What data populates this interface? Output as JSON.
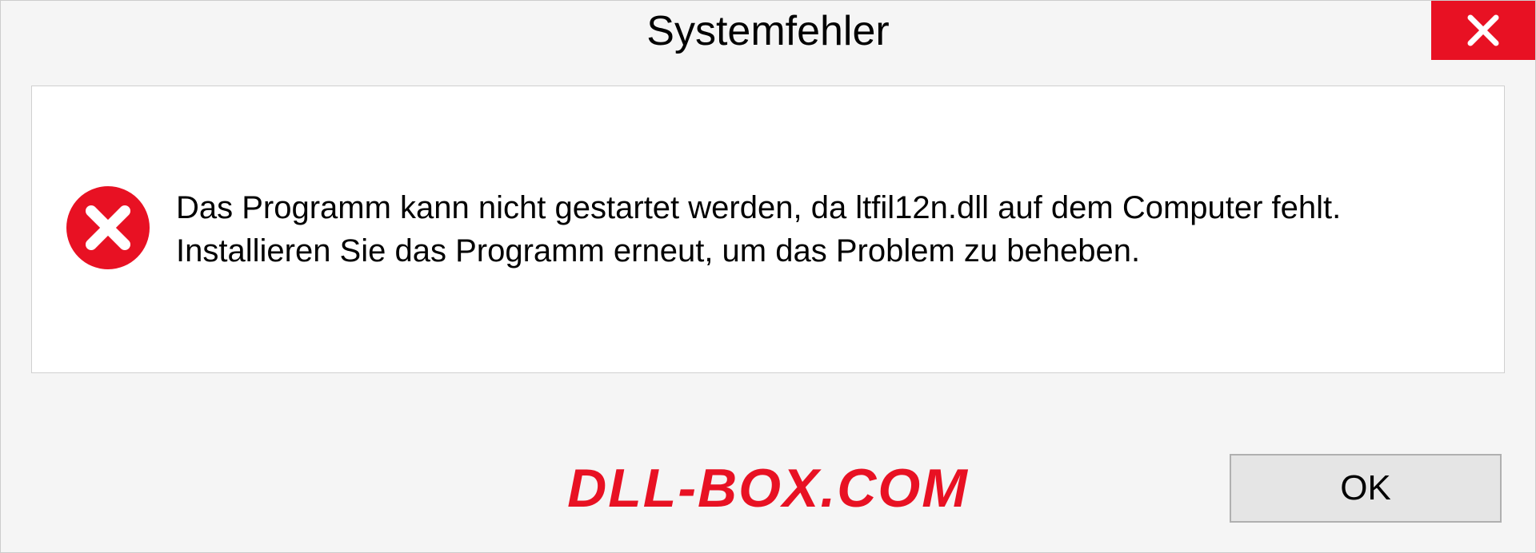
{
  "dialog": {
    "title": "Systemfehler",
    "message": "Das Programm kann nicht gestartet werden, da ltfil12n.dll auf dem Computer fehlt. Installieren Sie das Programm erneut, um das Problem zu beheben.",
    "ok_label": "OK"
  },
  "watermark": "DLL-BOX.COM"
}
